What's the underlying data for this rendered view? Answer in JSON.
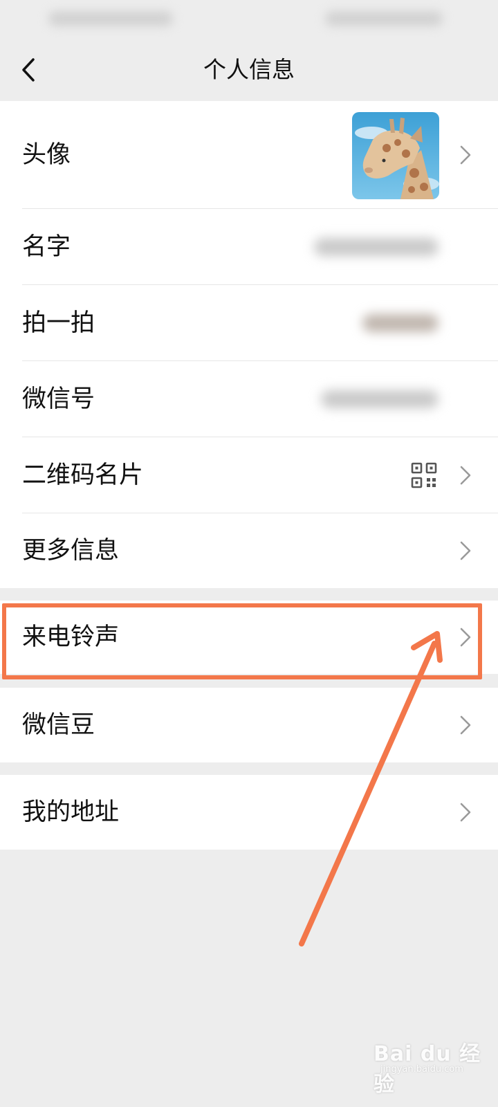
{
  "nav": {
    "title": "个人信息",
    "back_icon": "chevron-left-icon"
  },
  "rows": [
    {
      "label": "头像"
    },
    {
      "label": "名字"
    },
    {
      "label": "拍一拍"
    },
    {
      "label": "微信号"
    },
    {
      "label": "二维码名片"
    },
    {
      "label": "更多信息"
    },
    {
      "label": "来电铃声"
    },
    {
      "label": "微信豆"
    },
    {
      "label": "我的地址"
    }
  ],
  "icons": {
    "chevron": "chevron-right-icon",
    "qr": "qr-code-icon"
  },
  "annotation": {
    "highlight_color": "#f3774a",
    "highlighted_row": "来电铃声"
  },
  "watermark": {
    "brand": "Bai du 经验",
    "url": "jingyan.baidu.com"
  }
}
